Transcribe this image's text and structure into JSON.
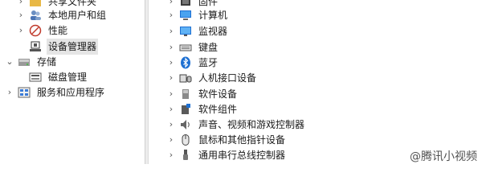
{
  "left_tree": {
    "items": [
      {
        "label": "共享文件夹",
        "icon": "shared-folder-icon",
        "expander": "›"
      },
      {
        "label": "本地用户和组",
        "icon": "users-icon",
        "expander": "›"
      },
      {
        "label": "性能",
        "icon": "performance-icon",
        "expander": "›"
      },
      {
        "label": "设备管理器",
        "icon": "device-manager-icon",
        "expander": ""
      },
      {
        "label": "存储",
        "icon": "storage-icon",
        "expander": "⌄"
      },
      {
        "label": "磁盘管理",
        "icon": "disk-icon",
        "expander": ""
      },
      {
        "label": "服务和应用程序",
        "icon": "services-icon",
        "expander": "›"
      }
    ]
  },
  "device_tree": {
    "items": [
      {
        "label": "固件",
        "icon": "firmware-icon"
      },
      {
        "label": "计算机",
        "icon": "computer-icon"
      },
      {
        "label": "监视器",
        "icon": "monitor-icon"
      },
      {
        "label": "键盘",
        "icon": "keyboard-icon"
      },
      {
        "label": "蓝牙",
        "icon": "bluetooth-icon"
      },
      {
        "label": "人机接口设备",
        "icon": "hid-icon"
      },
      {
        "label": "软件设备",
        "icon": "software-device-icon"
      },
      {
        "label": "软件组件",
        "icon": "software-component-icon"
      },
      {
        "label": "声音、视频和游戏控制器",
        "icon": "sound-icon"
      },
      {
        "label": "鼠标和其他指针设备",
        "icon": "mouse-icon"
      },
      {
        "label": "通用串行总线控制器",
        "icon": "usb-icon"
      }
    ],
    "expander": "›"
  },
  "watermark": "@腾讯小视频",
  "colors": {
    "accent": "#1e70d2",
    "selection": "#e5e5e5"
  }
}
